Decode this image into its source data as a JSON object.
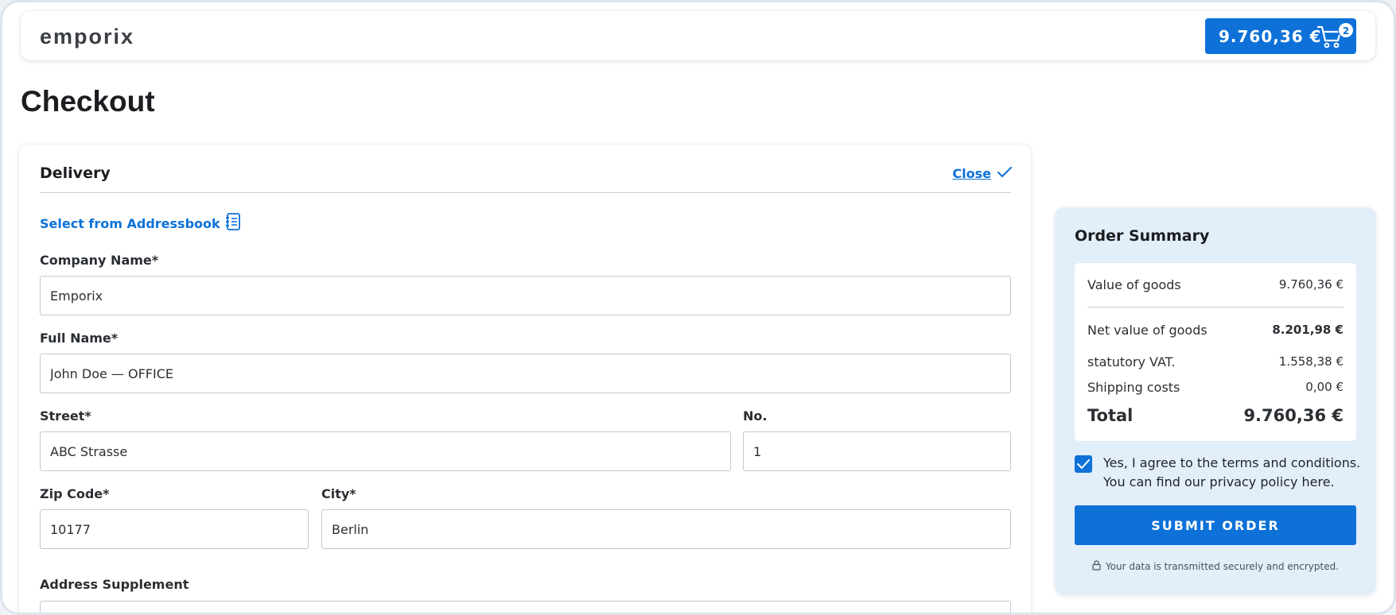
{
  "header": {
    "logo": "emporix",
    "cart_total": "9.760,36 €",
    "cart_count": "2"
  },
  "page_title": "Checkout",
  "delivery": {
    "title": "Delivery",
    "close_label": "Close",
    "addressbook_label": "Select from Addressbook",
    "fields": {
      "company": {
        "label": "Company Name*",
        "value": "Emporix"
      },
      "full_name": {
        "label": "Full Name*",
        "value": "John Doe — OFFICE"
      },
      "street": {
        "label": "Street*",
        "value": "ABC Strasse"
      },
      "number": {
        "label": "No.",
        "value": "1"
      },
      "zip": {
        "label": "Zip Code*",
        "value": "10177"
      },
      "city": {
        "label": "City*",
        "value": "Berlin"
      },
      "supplement": {
        "label": "Address Supplement",
        "value": ""
      }
    }
  },
  "summary": {
    "title": "Order Summary",
    "value_of_goods": {
      "label": "Value of goods",
      "value": "9.760,36 €"
    },
    "net_value": {
      "label": "Net value of goods",
      "value": "8.201,98 €"
    },
    "vat": {
      "label": "statutory VAT.",
      "value": "1.558,38 €"
    },
    "shipping": {
      "label": "Shipping costs",
      "value": "0,00 €"
    },
    "total": {
      "label": "Total",
      "value": "9.760,36 €"
    },
    "terms_line1": "Yes, I agree to the terms and conditions.",
    "terms_line2": "You can find our privacy policy here.",
    "terms_checked": true,
    "submit_label": "SUBMIT ORDER",
    "secure_note": "Your data is transmitted securely and encrypted."
  },
  "colors": {
    "accent": "#0d71d8",
    "summary_bg": "#e3eefb"
  }
}
